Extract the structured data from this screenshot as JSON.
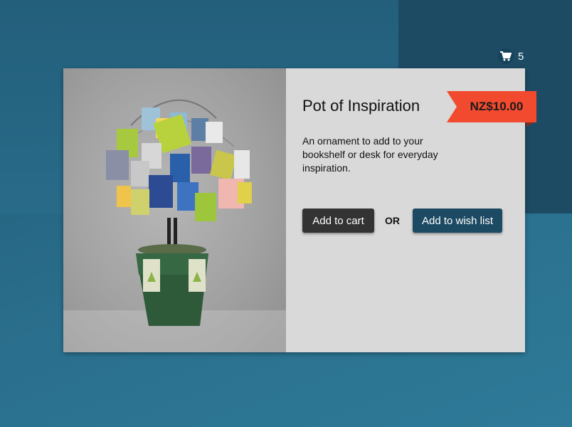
{
  "header": {
    "cart_count": "5",
    "cart_icon": "cart-icon"
  },
  "product": {
    "title": "Pot of Inspiration",
    "price": "NZ$10.00",
    "description": "An ornament to add to your bookshelf or desk for everyday inspiration.",
    "image_icon": "product-photo"
  },
  "actions": {
    "add_to_cart": "Add to cart",
    "or": "OR",
    "add_to_wish_list": "Add to wish list"
  },
  "colors": {
    "price_tag": "#f14a2e",
    "wish_button": "#1d4a63",
    "cart_button": "#333333"
  }
}
